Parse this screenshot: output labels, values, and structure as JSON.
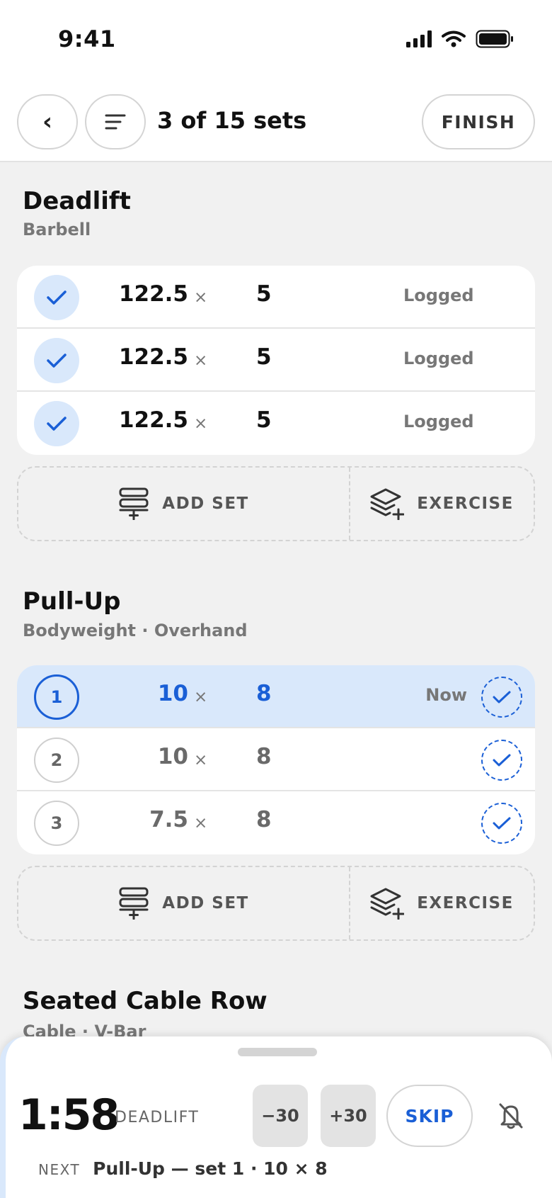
{
  "status_bar": {
    "time": "9:41"
  },
  "header": {
    "back_label": "‹",
    "progress_text": "3 of 15 sets",
    "finish_label": "FINISH"
  },
  "exercises": [
    {
      "name": "Deadlift",
      "equipment": "Barbell",
      "sets": [
        {
          "weight": "122.5",
          "times": "×",
          "reps": "5",
          "status": "Logged"
        },
        {
          "weight": "122.5",
          "times": "×",
          "reps": "5",
          "status": "Logged"
        },
        {
          "weight": "122.5",
          "times": "×",
          "reps": "5",
          "status": "Logged"
        }
      ],
      "actions": {
        "add_set": "ADD SET",
        "exercise": "EXERCISE"
      }
    },
    {
      "name": "Pull-Up",
      "equipment": "Bodyweight · Overhand",
      "sets": [
        {
          "number": "1",
          "weight": "10",
          "times": "×",
          "reps": "8",
          "status": "Now"
        },
        {
          "number": "2",
          "weight": "10",
          "times": "×",
          "reps": "8"
        },
        {
          "number": "3",
          "weight": "7.5",
          "times": "×",
          "reps": "8"
        }
      ],
      "actions": {
        "add_set": "ADD SET",
        "exercise": "EXERCISE"
      }
    },
    {
      "name": "Seated Cable Row",
      "equipment": "Cable · V-Bar"
    }
  ],
  "rest_timer": {
    "time": "1:58",
    "exercise": "DEADLIFT",
    "minus_label": "−30",
    "plus_label": "+30",
    "skip_label": "SKIP",
    "next_tag": "NEXT",
    "next_text": "Pull-Up — set 1 · 10 × 8"
  },
  "colors": {
    "accent": "#1a5fd6",
    "accent_light": "#d9e8fb",
    "background": "#f1f1f1"
  },
  "icons": [
    "signal-icon",
    "wifi-icon",
    "battery-icon",
    "list-menu-icon",
    "checkmark-icon",
    "add-set-icon",
    "layers-plus-icon",
    "bell-off-icon"
  ]
}
